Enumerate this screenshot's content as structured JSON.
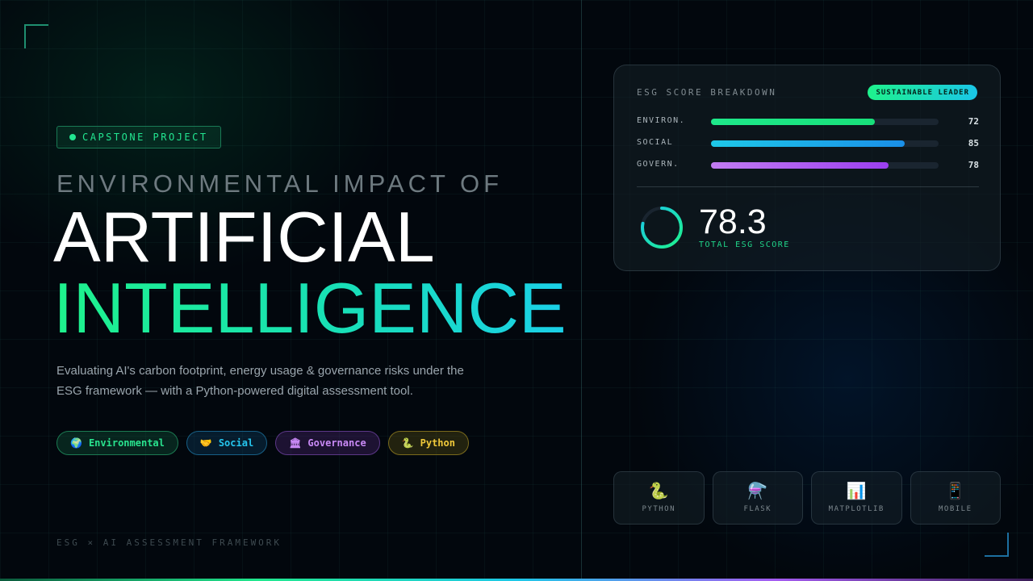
{
  "badge": {
    "label": "CAPSTONE PROJECT"
  },
  "hero": {
    "kicker": "ENVIRONMENTAL IMPACT OF",
    "title_line1": "ARTIFICIAL",
    "title_line2": "INTELLIGENCE",
    "description": "Evaluating AI's carbon footprint, energy usage & governance risks under the ESG framework — with a Python-powered digital assessment tool."
  },
  "tags": [
    {
      "label": "Environmental",
      "icon": "🌍",
      "icon_name": "globe-icon"
    },
    {
      "label": "Social",
      "icon": "🤝",
      "icon_name": "handshake-icon"
    },
    {
      "label": "Governance",
      "icon": "🏛",
      "icon_name": "institution-icon"
    },
    {
      "label": "Python",
      "icon": "🐍",
      "icon_name": "snake-icon"
    }
  ],
  "footer": "ESG × AI ASSESSMENT FRAMEWORK",
  "score_card": {
    "title": "ESG SCORE BREAKDOWN",
    "badge": "SUSTAINABLE LEADER",
    "rows": [
      {
        "label": "ENVIRON.",
        "value": "72",
        "percent": 72,
        "color_start": "#1ee88a",
        "color_end": "#18e07a"
      },
      {
        "label": "SOCIAL",
        "value": "85",
        "percent": 85,
        "color_start": "#1ec8e8",
        "color_end": "#1a8fe8"
      },
      {
        "label": "GOVERN.",
        "value": "78",
        "percent": 78,
        "color_start": "#c27cf2",
        "color_end": "#9b3ff0"
      }
    ],
    "total": {
      "value": "78.3",
      "label": "TOTAL ESG SCORE",
      "percent": 78.3
    }
  },
  "tools": [
    {
      "name": "PYTHON",
      "icon": "🐍",
      "icon_name": "python-icon"
    },
    {
      "name": "FLASK",
      "icon": "⚗️",
      "icon_name": "flask-icon"
    },
    {
      "name": "MATPLOTLIB",
      "icon": "📊",
      "icon_name": "bar-chart-icon"
    },
    {
      "name": "MOBILE",
      "icon": "📱",
      "icon_name": "mobile-phone-icon"
    }
  ],
  "colors": {
    "accent_green": "#22e590",
    "accent_cyan": "#1ac6e8",
    "accent_purple": "#a55cf2",
    "accent_yellow": "#f0c93a",
    "background": "#02070d"
  }
}
